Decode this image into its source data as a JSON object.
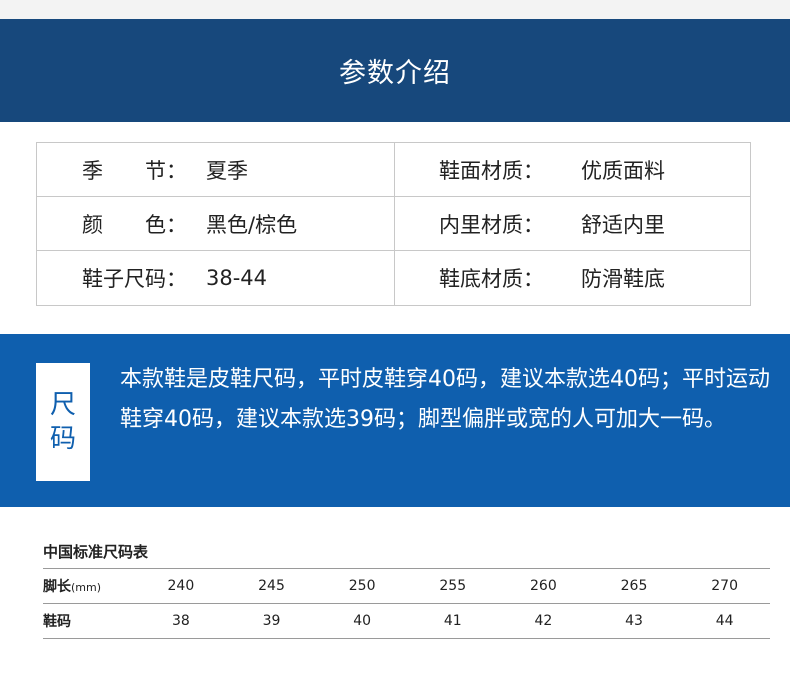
{
  "header": {
    "title": "参数介绍"
  },
  "specs": {
    "rows": [
      {
        "left_label": "季　　节：",
        "left_value": "夏季",
        "right_label": "鞋面材质：",
        "right_value": "优质面料"
      },
      {
        "left_label": "颜　　色：",
        "left_value": "黑色/棕色",
        "right_label": "内里材质：",
        "right_value": "舒适内里"
      },
      {
        "left_label": "鞋子尺码：",
        "left_value": "38-44",
        "right_label": "鞋底材质：",
        "right_value": "防滑鞋底"
      }
    ]
  },
  "size_note": {
    "badge_line1": "尺",
    "badge_line2": "码",
    "text": "本款鞋是皮鞋尺码，平时皮鞋穿40码，建议本款选40码；平时运动鞋穿40码，建议本款选39码；脚型偏胖或宽的人可加大一码。"
  },
  "size_chart": {
    "title": "中国标准尺码表",
    "foot_length_label": "脚长",
    "foot_length_unit": "(mm)",
    "shoe_size_label": "鞋码",
    "foot_lengths": [
      "240",
      "245",
      "250",
      "255",
      "260",
      "265",
      "270"
    ],
    "shoe_sizes": [
      "38",
      "39",
      "40",
      "41",
      "42",
      "43",
      "44"
    ]
  },
  "colors": {
    "header_bg": "#17487c",
    "size_band_bg": "#0f5fae",
    "border": "#c8c8c8"
  }
}
